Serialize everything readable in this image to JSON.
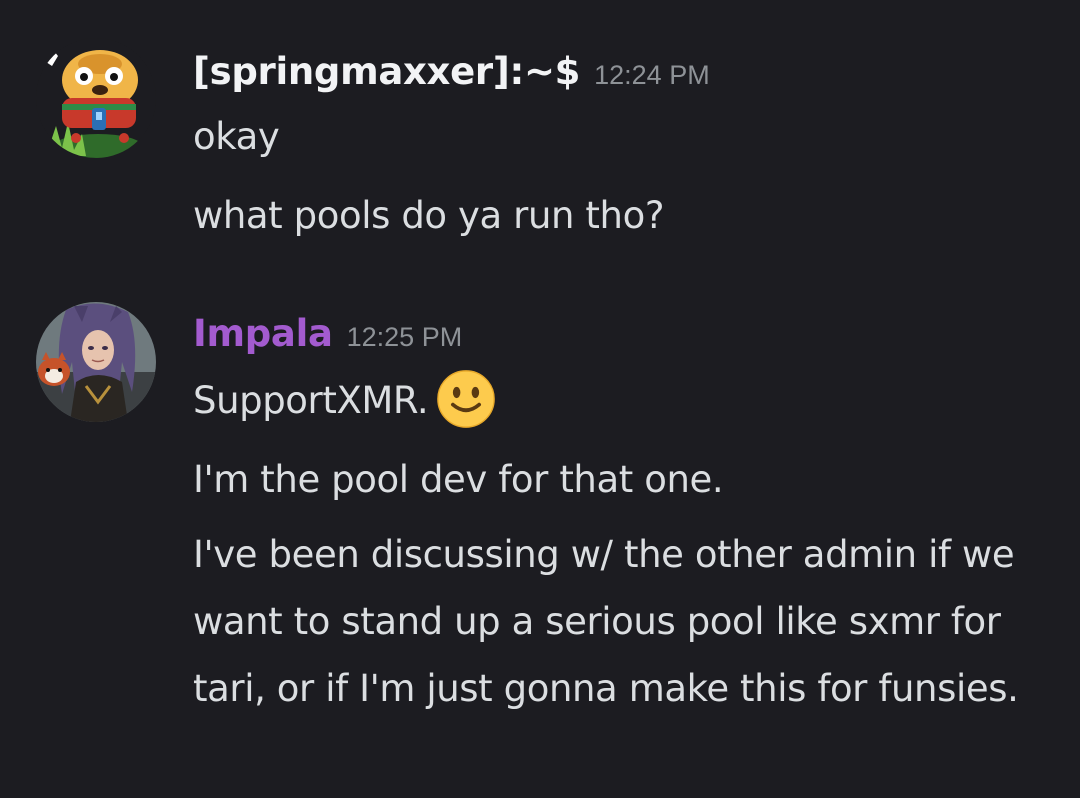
{
  "messages": [
    {
      "author": "[springmaxxer]:~$",
      "timestamp": "12:24 PM",
      "lines": [
        "okay",
        "what pools do ya run tho?"
      ]
    },
    {
      "author": "Impala",
      "timestamp": "12:25 PM",
      "lines": [
        "SupportXMR.",
        "I'm the pool dev for that one.",
        "I've been discussing w/ the other admin if we want to stand up a serious pool like sxmr for tari, or if I'm just gonna make this for funsies."
      ]
    }
  ],
  "icons": {
    "avatar1": "cartoon-dog-avatar",
    "avatar2": "character-portrait-avatar",
    "emoji": "slightly-smiling-face-emoji"
  },
  "colors": {
    "background": "#1c1c21",
    "username1": "#f2f3f5",
    "username2": "#a35bcf",
    "timestamp": "#8e9297",
    "message_text": "#dbdee1"
  }
}
